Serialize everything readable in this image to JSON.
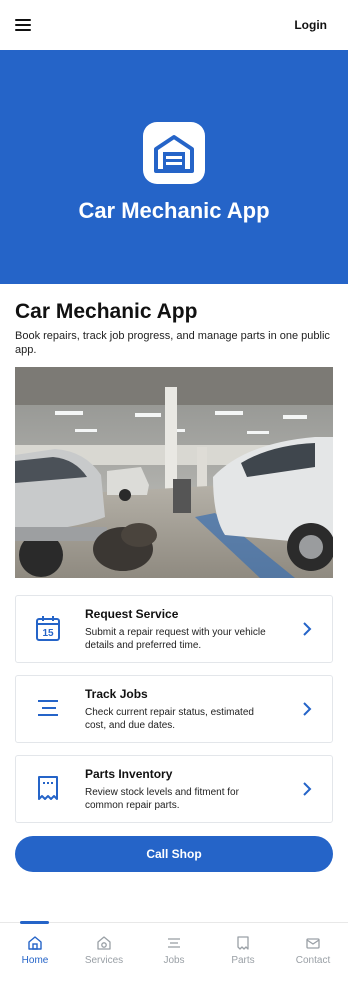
{
  "header": {
    "login_label": "Login"
  },
  "hero": {
    "title": "Car Mechanic App"
  },
  "main": {
    "title": "Car Mechanic App",
    "subtitle": "Book repairs, track job progress, and manage parts in one public app."
  },
  "cards": [
    {
      "title": "Request Service",
      "description": "Submit a repair request with your vehicle details and preferred time.",
      "icon": "calendar-icon",
      "icon_text": "15"
    },
    {
      "title": "Track Jobs",
      "description": "Check current repair status, estimated cost, and due dates.",
      "icon": "list-icon"
    },
    {
      "title": "Parts Inventory",
      "description": "Review stock levels and fitment for common repair parts.",
      "icon": "receipt-icon"
    }
  ],
  "call_button": {
    "label": "Call Shop"
  },
  "tabs": [
    {
      "label": "Home",
      "icon": "home-icon",
      "active": true
    },
    {
      "label": "Services",
      "icon": "services-icon",
      "active": false
    },
    {
      "label": "Jobs",
      "icon": "jobs-icon",
      "active": false
    },
    {
      "label": "Parts",
      "icon": "parts-icon",
      "active": false
    },
    {
      "label": "Contact",
      "icon": "mail-icon",
      "active": false
    }
  ],
  "colors": {
    "brand": "#2564c8",
    "inactive": "#9aa0a6"
  }
}
